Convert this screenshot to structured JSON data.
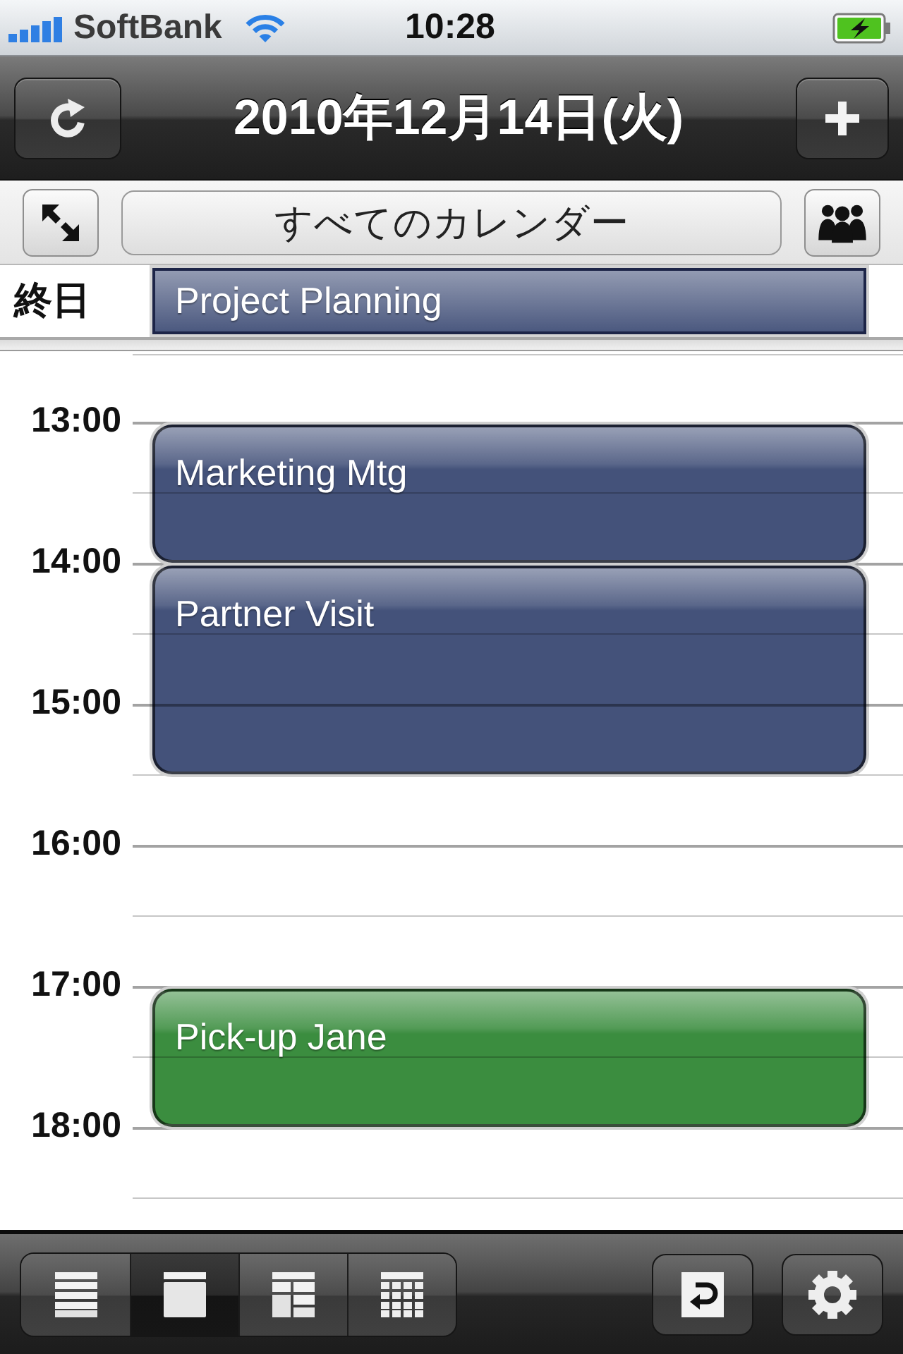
{
  "status_bar": {
    "carrier": "SoftBank",
    "time": "10:28",
    "charging": true
  },
  "nav_bar": {
    "title": "2010年12月14日(火)"
  },
  "toolbar": {
    "calendar_selector": "すべてのカレンダー"
  },
  "all_day": {
    "label": "終日",
    "events": [
      {
        "title": "Project Planning",
        "color": "#44527a"
      }
    ]
  },
  "timeline": {
    "slots": [
      {
        "kind": "half",
        "continued": false
      },
      {
        "kind": "hour",
        "label": "13:00",
        "event": {
          "title": "Marketing Mtg",
          "color": "#44527a"
        },
        "continued": false
      },
      {
        "kind": "half",
        "continued": true
      },
      {
        "kind": "hour",
        "label": "14:00",
        "event": {
          "title": "Partner Visit",
          "color": "#44527a"
        },
        "continued": false
      },
      {
        "kind": "half",
        "continued": true
      },
      {
        "kind": "hour",
        "label": "15:00",
        "continued": true
      },
      {
        "kind": "half",
        "continued": false
      },
      {
        "kind": "hour",
        "label": "16:00",
        "continued": false
      },
      {
        "kind": "half",
        "continued": false
      },
      {
        "kind": "hour",
        "label": "17:00",
        "event": {
          "title": "Pick-up Jane",
          "color": "#3b8d3f"
        },
        "continued": false
      },
      {
        "kind": "half",
        "continued": true
      },
      {
        "kind": "hour",
        "label": "18:00",
        "continued": false
      },
      {
        "kind": "half",
        "continued": false
      }
    ]
  },
  "bottom_bar": {
    "views": [
      {
        "kind": "list",
        "selected": false
      },
      {
        "kind": "day",
        "selected": true
      },
      {
        "kind": "week",
        "selected": false
      },
      {
        "kind": "month",
        "selected": false
      }
    ]
  }
}
